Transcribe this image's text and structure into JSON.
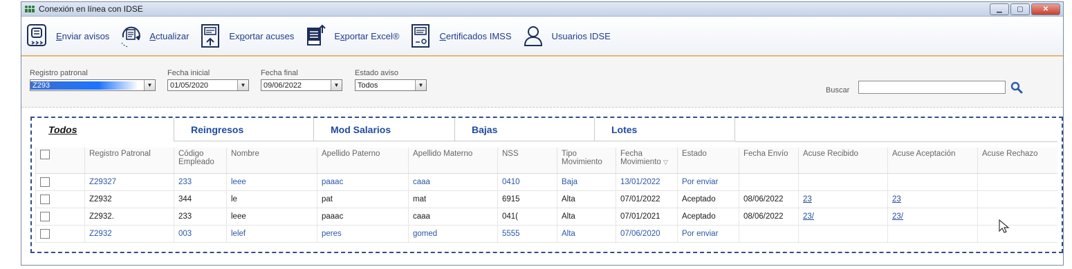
{
  "window": {
    "title": "Conexión en línea con IDSE",
    "controls": [
      "minimize",
      "maximize",
      "close"
    ]
  },
  "toolbar": {
    "items": [
      {
        "pre": "",
        "u": "E",
        "post": "nviar avisos",
        "icon": "send-icon"
      },
      {
        "pre": "",
        "u": "A",
        "post": "ctualizar",
        "icon": "refresh-icon"
      },
      {
        "pre": "Ex",
        "u": "p",
        "post": "ortar acuses",
        "icon": "export-receipts-icon"
      },
      {
        "pre": "E",
        "u": "x",
        "post": "portar Excel®",
        "icon": "excel-export-icon"
      },
      {
        "pre": "",
        "u": "C",
        "post": "ertificados IMSS",
        "icon": "certificate-icon"
      },
      {
        "pre": "",
        "u": "",
        "post": "Usuarios IDSE",
        "icon": "user-icon"
      }
    ]
  },
  "filters": {
    "registro_patronal": {
      "label": "Registro patronal",
      "value": "Z293"
    },
    "fecha_inicial": {
      "label": "Fecha inicial",
      "value": "01/05/2020"
    },
    "fecha_final": {
      "label": "Fecha final",
      "value": "09/06/2022"
    },
    "estado_aviso": {
      "label": "Estado aviso",
      "value": "Todos"
    },
    "search": {
      "label": "Buscar",
      "value": ""
    }
  },
  "tabs": [
    "Todos",
    "Reingresos",
    "Mod Salarios",
    "Bajas",
    "Lotes"
  ],
  "table": {
    "columns": [
      "",
      "Registro Patronal",
      "Código Empleado",
      "Nombre",
      "Apellido Paterno",
      "Apellido Materno",
      "NSS",
      "Tipo Movimiento",
      "Fecha Movimiento",
      "Estado",
      "Fecha Envío",
      "Acuse Recibido",
      "Acuse Aceptación",
      "Acuse Rechazo"
    ],
    "rows": [
      {
        "registro": "Z29327",
        "codigo": "233",
        "nombre": "leee",
        "ap_paterno": "paaac",
        "ap_materno": "caaa",
        "nss": "0410",
        "tipo": "Baja",
        "fecha_mov": "13/01/2022",
        "estado": "Por enviar",
        "fecha_envio": "",
        "acuse_recibido": "",
        "acuse_aceptacion": "",
        "acuse_rechazo": ""
      },
      {
        "registro": "Z2932",
        "codigo": "344",
        "nombre": "le",
        "ap_paterno": "pat",
        "ap_materno": "mat",
        "nss": "6915",
        "tipo": "Alta",
        "fecha_mov": "07/01/2022",
        "estado": "Aceptado",
        "fecha_envio": "08/06/2022",
        "acuse_recibido": "23",
        "acuse_aceptacion": "23",
        "acuse_rechazo": ""
      },
      {
        "registro": "Z2932.",
        "codigo": "233",
        "nombre": "leee",
        "ap_paterno": "paaac",
        "ap_materno": "caaa",
        "nss": "041(",
        "tipo": "Alta",
        "fecha_mov": "07/01/2021",
        "estado": "Aceptado",
        "fecha_envio": "08/06/2022",
        "acuse_recibido": "23/",
        "acuse_aceptacion": "23/",
        "acuse_rechazo": ""
      },
      {
        "registro": "Z2932",
        "codigo": "003",
        "nombre": "lelef",
        "ap_paterno": "peres",
        "ap_materno": "gomed",
        "nss": "5555",
        "tipo": "Alta",
        "fecha_mov": "07/06/2020",
        "estado": "Por enviar",
        "fecha_envio": "",
        "acuse_recibido": "",
        "acuse_aceptacion": "",
        "acuse_rechazo": ""
      }
    ]
  }
}
